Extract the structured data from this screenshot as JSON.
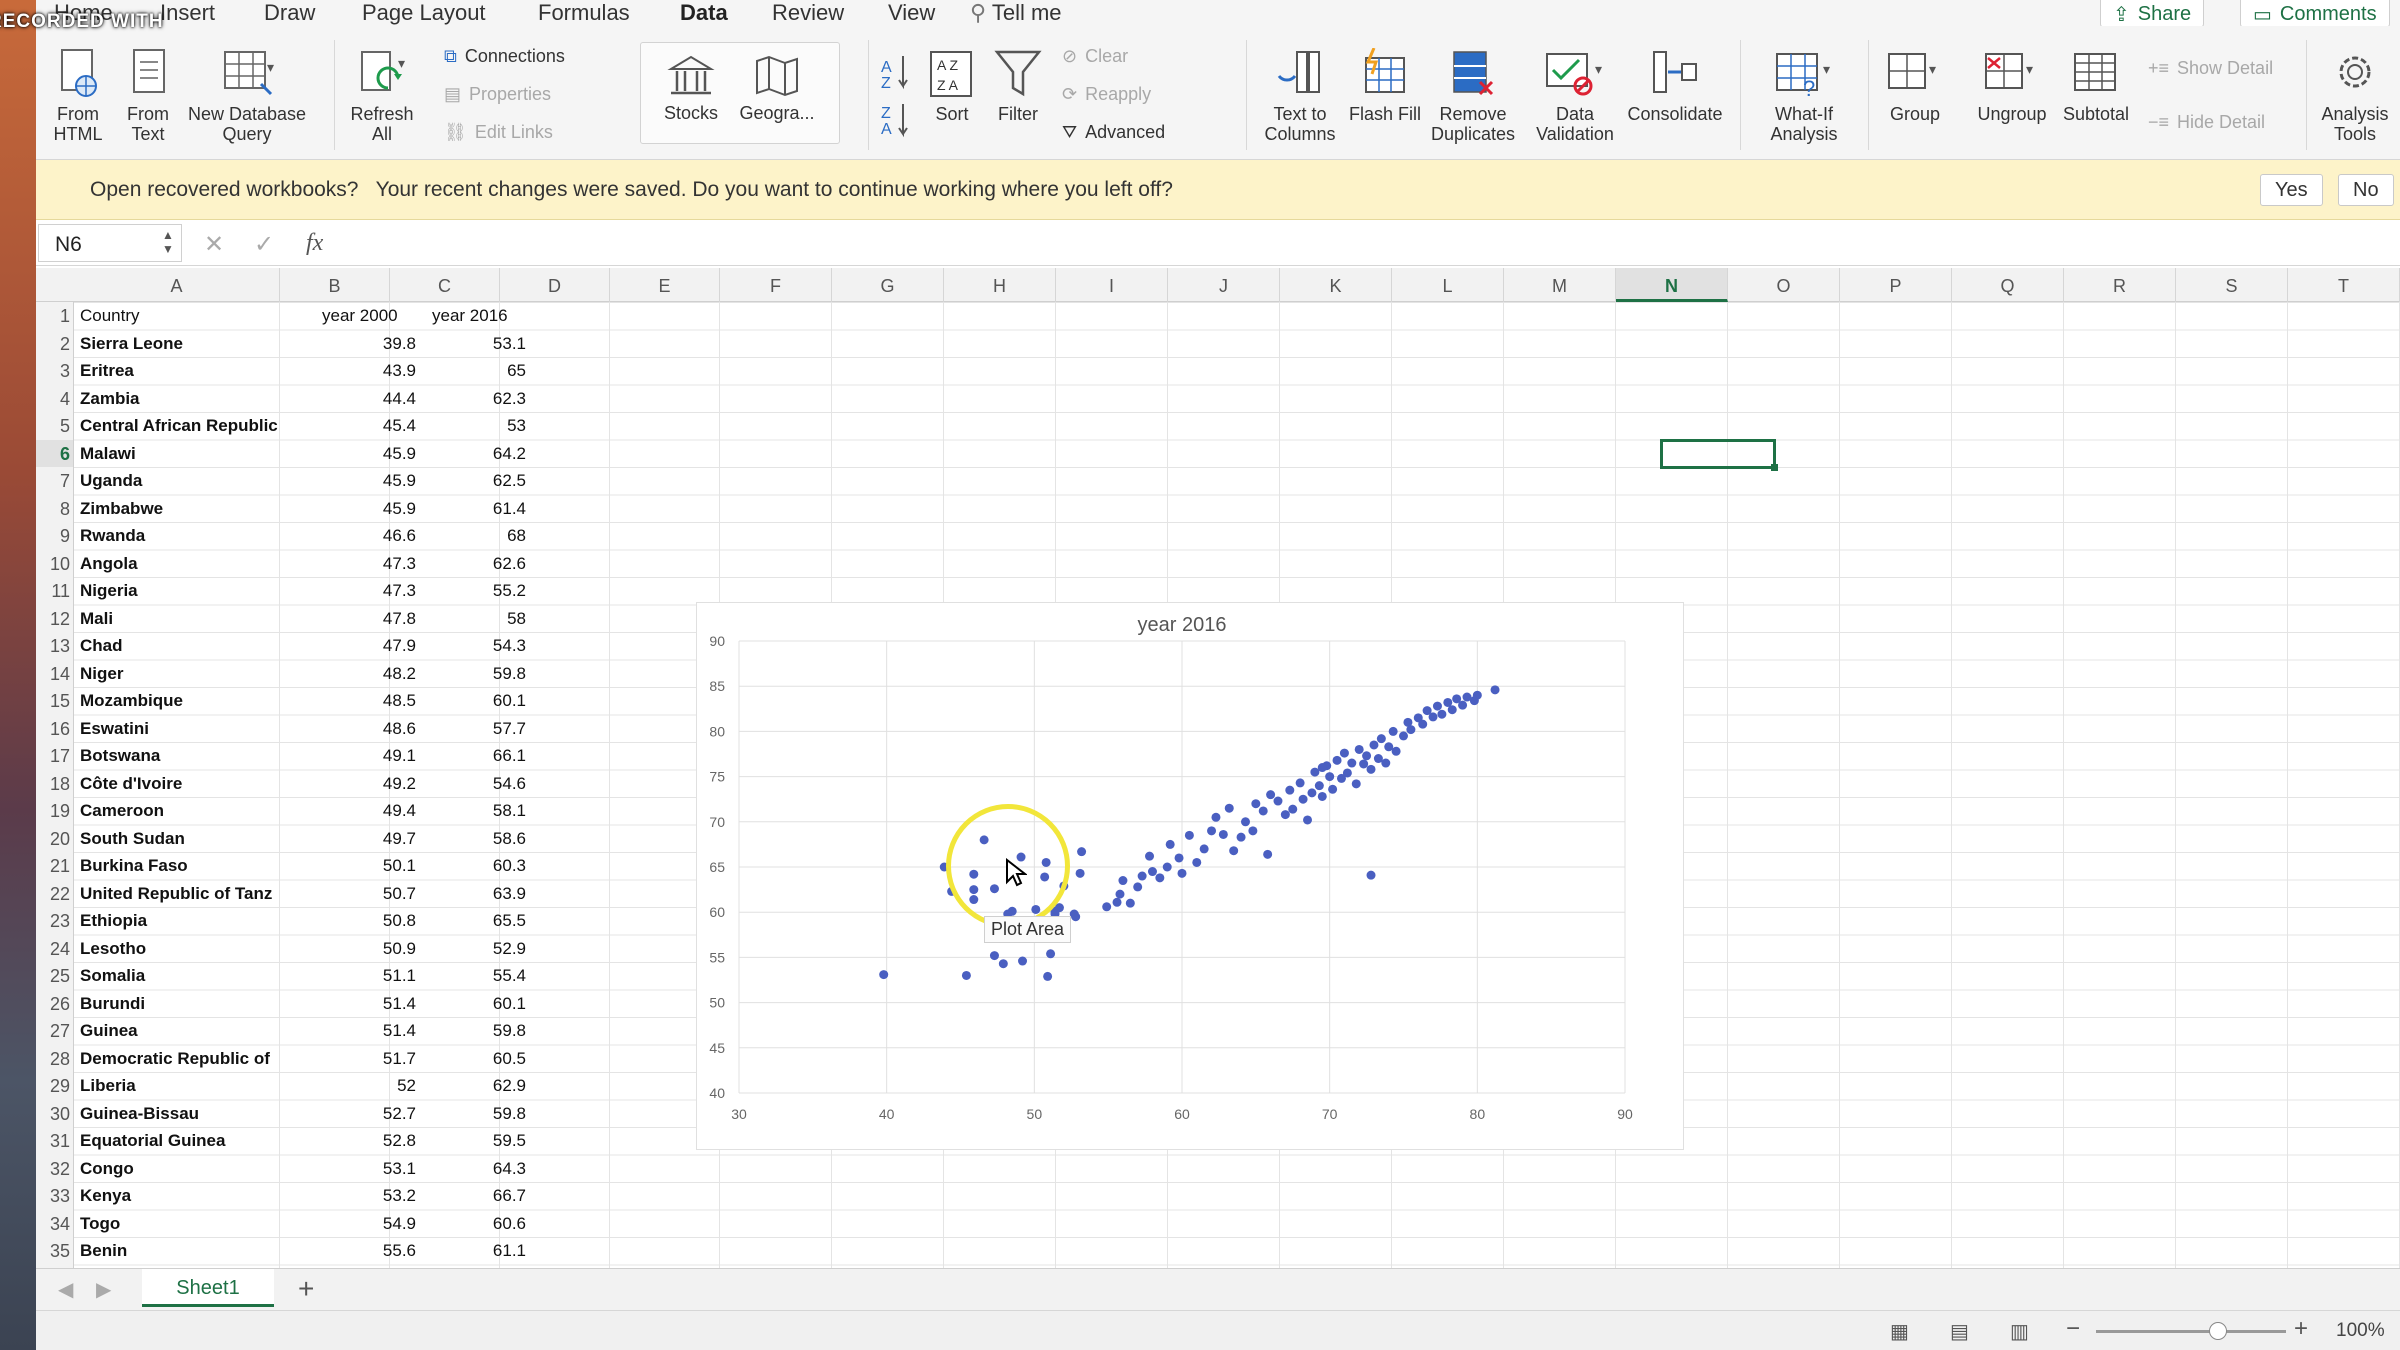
{
  "ribbon_tabs": [
    "Home",
    "Insert",
    "Draw",
    "Page Layout",
    "Formulas",
    "Data",
    "Review",
    "View",
    "Tell me"
  ],
  "active_tab": "Data",
  "share_label": "Share",
  "comments_label": "Comments",
  "ribbon": {
    "from_html": "From HTML",
    "from_text": "From Text",
    "new_db_query": "New Database Query",
    "refresh_all": "Refresh All",
    "connections": "Connections",
    "properties": "Properties",
    "edit_links": "Edit Links",
    "stocks": "Stocks",
    "geography": "Geogra...",
    "sort": "Sort",
    "filter": "Filter",
    "clear": "Clear",
    "reapply": "Reapply",
    "advanced": "Advanced",
    "text_to_columns": "Text to Columns",
    "flash_fill": "Flash Fill",
    "remove_duplicates": "Remove Duplicates",
    "data_validation": "Data Validation",
    "consolidate": "Consolidate",
    "what_if": "What-If Analysis",
    "group": "Group",
    "ungroup": "Ungroup",
    "subtotal": "Subtotal",
    "show_detail": "Show Detail",
    "hide_detail": "Hide Detail",
    "analysis_tools": "Analysis Tools"
  },
  "message_bar": {
    "title": "Open recovered workbooks?",
    "text": "Your recent changes were saved. Do you want to continue working where you left off?",
    "yes": "Yes",
    "no": "No"
  },
  "formula_bar": {
    "name_box": "N6",
    "fx": "fx"
  },
  "columns": [
    "A",
    "B",
    "C",
    "D",
    "E",
    "F",
    "G",
    "H",
    "I",
    "J",
    "K",
    "L",
    "M",
    "N",
    "O",
    "P",
    "Q",
    "R",
    "S",
    "T"
  ],
  "selected_column": "N",
  "selected_row": 6,
  "header_row": {
    "a": "Country",
    "b": "year 2000",
    "c": "year 2016"
  },
  "rows": [
    {
      "a": "Sierra Leone",
      "b": "39.8",
      "c": "53.1"
    },
    {
      "a": "Eritrea",
      "b": "43.9",
      "c": "65"
    },
    {
      "a": "Zambia",
      "b": "44.4",
      "c": "62.3"
    },
    {
      "a": "Central African Republic",
      "b": "45.4",
      "c": "53"
    },
    {
      "a": "Malawi",
      "b": "45.9",
      "c": "64.2"
    },
    {
      "a": "Uganda",
      "b": "45.9",
      "c": "62.5"
    },
    {
      "a": "Zimbabwe",
      "b": "45.9",
      "c": "61.4"
    },
    {
      "a": "Rwanda",
      "b": "46.6",
      "c": "68"
    },
    {
      "a": "Angola",
      "b": "47.3",
      "c": "62.6"
    },
    {
      "a": "Nigeria",
      "b": "47.3",
      "c": "55.2"
    },
    {
      "a": "Mali",
      "b": "47.8",
      "c": "58"
    },
    {
      "a": "Chad",
      "b": "47.9",
      "c": "54.3"
    },
    {
      "a": "Niger",
      "b": "48.2",
      "c": "59.8"
    },
    {
      "a": "Mozambique",
      "b": "48.5",
      "c": "60.1"
    },
    {
      "a": "Eswatini",
      "b": "48.6",
      "c": "57.7"
    },
    {
      "a": "Botswana",
      "b": "49.1",
      "c": "66.1"
    },
    {
      "a": "Côte d'Ivoire",
      "b": "49.2",
      "c": "54.6"
    },
    {
      "a": "Cameroon",
      "b": "49.4",
      "c": "58.1"
    },
    {
      "a": "South Sudan",
      "b": "49.7",
      "c": "58.6"
    },
    {
      "a": "Burkina Faso",
      "b": "50.1",
      "c": "60.3"
    },
    {
      "a": "United Republic of Tanz",
      "b": "50.7",
      "c": "63.9"
    },
    {
      "a": "Ethiopia",
      "b": "50.8",
      "c": "65.5"
    },
    {
      "a": "Lesotho",
      "b": "50.9",
      "c": "52.9"
    },
    {
      "a": "Somalia",
      "b": "51.1",
      "c": "55.4"
    },
    {
      "a": "Burundi",
      "b": "51.4",
      "c": "60.1"
    },
    {
      "a": "Guinea",
      "b": "51.4",
      "c": "59.8"
    },
    {
      "a": "Democratic Republic of",
      "b": "51.7",
      "c": "60.5"
    },
    {
      "a": "Liberia",
      "b": "52",
      "c": "62.9"
    },
    {
      "a": "Guinea-Bissau",
      "b": "52.7",
      "c": "59.8"
    },
    {
      "a": "Equatorial Guinea",
      "b": "52.8",
      "c": "59.5"
    },
    {
      "a": "Congo",
      "b": "53.1",
      "c": "64.3"
    },
    {
      "a": "Kenya",
      "b": "53.2",
      "c": "66.7"
    },
    {
      "a": "Togo",
      "b": "54.9",
      "c": "60.6"
    },
    {
      "a": "Benin",
      "b": "55.6",
      "c": "61.1"
    }
  ],
  "chart_data": {
    "type": "scatter",
    "title": "year 2016",
    "xlabel": "",
    "ylabel": "",
    "xlim": [
      30,
      90
    ],
    "ylim": [
      40,
      90
    ],
    "xticks": [
      30,
      40,
      50,
      60,
      70,
      80,
      90
    ],
    "yticks": [
      40,
      45,
      50,
      55,
      60,
      65,
      70,
      75,
      80,
      85,
      90
    ],
    "grid": true,
    "color": "#4a5fc1",
    "points": [
      [
        39.8,
        53.1
      ],
      [
        43.9,
        65
      ],
      [
        44.4,
        62.3
      ],
      [
        45.4,
        53
      ],
      [
        45.9,
        64.2
      ],
      [
        45.9,
        62.5
      ],
      [
        45.9,
        61.4
      ],
      [
        46.6,
        68
      ],
      [
        47.3,
        62.6
      ],
      [
        47.3,
        55.2
      ],
      [
        47.8,
        58
      ],
      [
        47.9,
        54.3
      ],
      [
        48.2,
        59.8
      ],
      [
        48.5,
        60.1
      ],
      [
        48.6,
        57.7
      ],
      [
        49.1,
        66.1
      ],
      [
        49.2,
        54.6
      ],
      [
        49.4,
        58.1
      ],
      [
        49.7,
        58.6
      ],
      [
        50.1,
        60.3
      ],
      [
        50.7,
        63.9
      ],
      [
        50.8,
        65.5
      ],
      [
        50.9,
        52.9
      ],
      [
        51.1,
        55.4
      ],
      [
        51.4,
        60.1
      ],
      [
        51.4,
        59.8
      ],
      [
        51.7,
        60.5
      ],
      [
        52,
        62.9
      ],
      [
        52.7,
        59.8
      ],
      [
        52.8,
        59.5
      ],
      [
        53.1,
        64.3
      ],
      [
        53.2,
        66.7
      ],
      [
        54.9,
        60.6
      ],
      [
        55.6,
        61.1
      ],
      [
        55.8,
        62
      ],
      [
        56,
        63.5
      ],
      [
        56.5,
        61
      ],
      [
        57,
        62.8
      ],
      [
        57.3,
        64
      ],
      [
        57.8,
        66.2
      ],
      [
        58,
        64.5
      ],
      [
        58.5,
        63.8
      ],
      [
        59,
        65
      ],
      [
        59.2,
        67.5
      ],
      [
        59.8,
        66
      ],
      [
        60,
        64.3
      ],
      [
        60.5,
        68.5
      ],
      [
        61,
        65.5
      ],
      [
        61.5,
        67
      ],
      [
        62,
        69
      ],
      [
        62.3,
        70.5
      ],
      [
        62.8,
        68.6
      ],
      [
        63.2,
        71.5
      ],
      [
        63.5,
        66.8
      ],
      [
        64,
        68.3
      ],
      [
        64.3,
        70
      ],
      [
        64.8,
        69
      ],
      [
        65,
        72
      ],
      [
        65.5,
        71.2
      ],
      [
        65.8,
        66.4
      ],
      [
        66,
        73
      ],
      [
        66.5,
        72.3
      ],
      [
        67,
        70.8
      ],
      [
        67.3,
        73.5
      ],
      [
        67.5,
        71.4
      ],
      [
        68,
        74.3
      ],
      [
        68.2,
        72.5
      ],
      [
        68.5,
        70.2
      ],
      [
        68.8,
        73.2
      ],
      [
        69,
        75.5
      ],
      [
        69.3,
        74
      ],
      [
        69.5,
        72.8
      ],
      [
        69.8,
        76.2
      ],
      [
        70,
        75
      ],
      [
        70.2,
        73.6
      ],
      [
        70.5,
        76.8
      ],
      [
        70.8,
        74.8
      ],
      [
        71,
        77.6
      ],
      [
        71.2,
        75.4
      ],
      [
        71.5,
        76.5
      ],
      [
        71.8,
        74.2
      ],
      [
        72,
        78
      ],
      [
        72.3,
        76.4
      ],
      [
        72.5,
        77.3
      ],
      [
        72.8,
        75.8
      ],
      [
        73,
        78.5
      ],
      [
        73.3,
        77
      ],
      [
        73.5,
        79.2
      ],
      [
        73.8,
        76.5
      ],
      [
        74,
        78.3
      ],
      [
        74.3,
        80
      ],
      [
        74.5,
        77.8
      ],
      [
        75,
        79.5
      ],
      [
        75.3,
        81
      ],
      [
        75.5,
        80.2
      ],
      [
        76,
        81.5
      ],
      [
        76.3,
        80.8
      ],
      [
        76.6,
        82.3
      ],
      [
        77,
        81.6
      ],
      [
        77.3,
        82.8
      ],
      [
        77.6,
        81.9
      ],
      [
        78,
        83.2
      ],
      [
        78.3,
        82.4
      ],
      [
        78.6,
        83.6
      ],
      [
        79,
        82.9
      ],
      [
        79.3,
        83.8
      ],
      [
        79.8,
        83.4
      ],
      [
        80,
        84
      ],
      [
        81.2,
        84.6
      ],
      [
        72.8,
        64.1
      ],
      [
        69.5,
        76
      ]
    ]
  },
  "tooltip": "Plot Area",
  "sheet_tab": "Sheet1",
  "zoom": "100%",
  "watermark": "RECORDED WITH"
}
